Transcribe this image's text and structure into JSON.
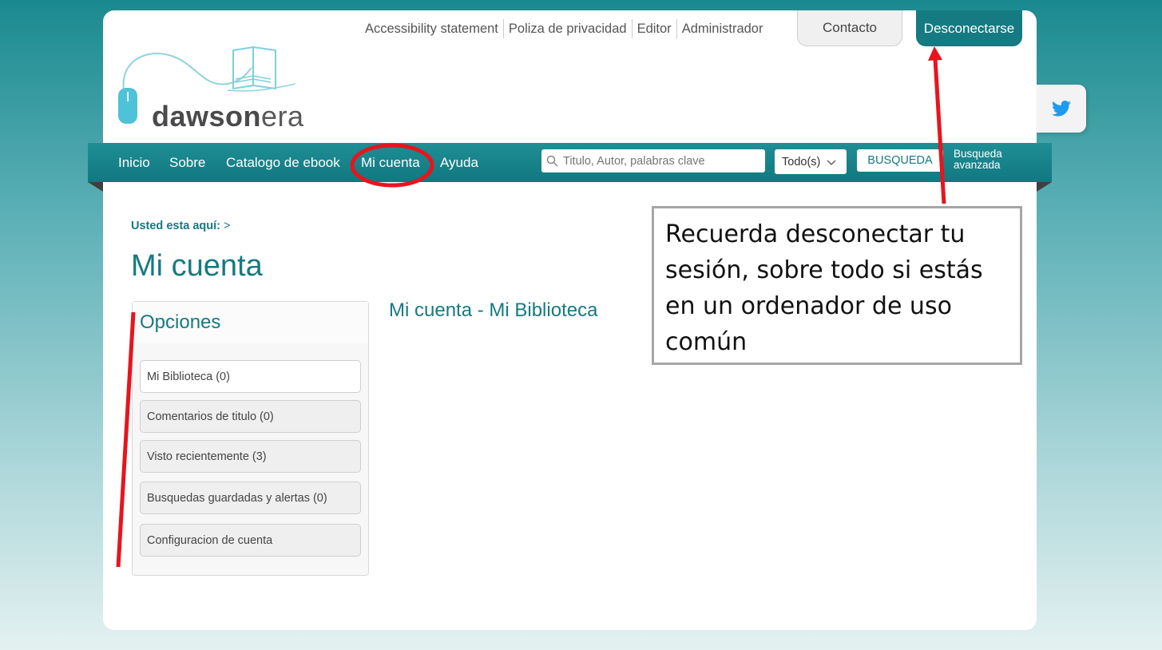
{
  "top_links": [
    "Accessibility statement",
    "Poliza de privacidad",
    "Editor",
    "Administrador"
  ],
  "contacto_label": "Contacto",
  "logout_label": "Desconectarse",
  "logo": {
    "text_main": "dawson",
    "text_suffix": "era"
  },
  "nav": {
    "items": [
      "Inicio",
      "Sobre",
      "Catalogo de ebook",
      "Mi cuenta",
      "Ayuda"
    ],
    "search_placeholder": "Titulo, Autor, palabras clave",
    "scope_select": "Todo(s)",
    "search_button": "BUSQUEDA",
    "advanced_search": "Busqueda avanzada"
  },
  "breadcrumb": {
    "label": "Usted esta aquí:",
    "sep": ">"
  },
  "page_title": "Mi cuenta",
  "sidebar": {
    "title": "Opciones",
    "items": [
      "Mi Biblioteca (0)",
      "Comentarios de titulo (0)",
      "Visto recientemente (3)",
      "Busquedas guardadas y alertas (0)",
      "Configuracion de cuenta"
    ]
  },
  "main": {
    "section_title": "Mi cuenta - Mi Biblioteca"
  },
  "callout": {
    "text": "Recuerda desconectar tu sesión, sobre todo si estás en un ordenador de uso común"
  },
  "colors": {
    "brand": "#157a81",
    "annotation": "#e8141c"
  },
  "icons": [
    "search-icon",
    "chevron-down-icon",
    "twitter-icon"
  ]
}
